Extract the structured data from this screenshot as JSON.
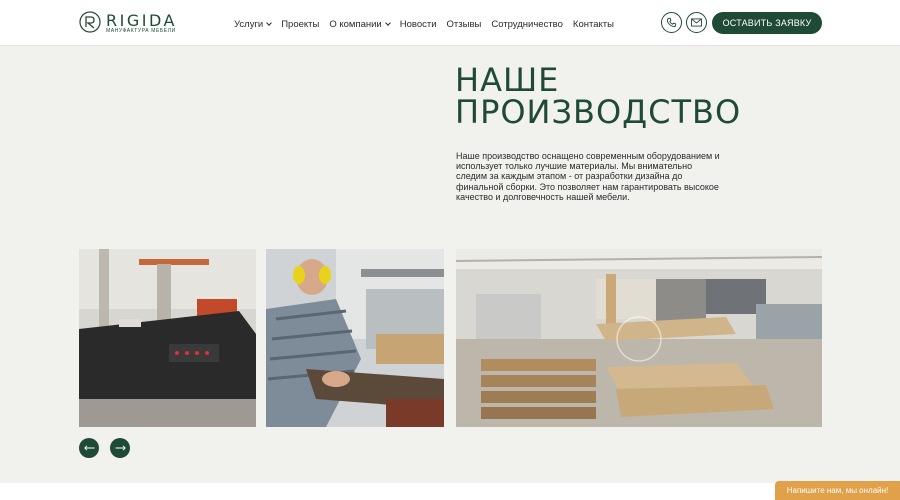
{
  "brand": {
    "name": "RIGIDA",
    "subtitle": "МАНУФАКТУРА МЕБЕЛИ"
  },
  "nav": [
    {
      "label": "Услуги",
      "dropdown": true
    },
    {
      "label": "Проекты",
      "dropdown": false
    },
    {
      "label": "О компании",
      "dropdown": true
    },
    {
      "label": "Новости",
      "dropdown": false
    },
    {
      "label": "Отзывы",
      "dropdown": false
    },
    {
      "label": "Сотрудничество",
      "dropdown": false
    },
    {
      "label": "Контакты",
      "dropdown": false
    }
  ],
  "header_icons": [
    "phone-icon",
    "mail-icon"
  ],
  "cta_label": "ОСТАВИТЬ ЗАЯВКУ",
  "hero": {
    "title_line1": "НАШЕ",
    "title_line2": "ПРОИЗВОДСТВО",
    "description": "Наше производство оснащено современным оборудованием и использует только лучшие материалы. Мы внимательно следим за каждым этапом - от разработки дизайна до финальной сборки. Это позволяет нам гарантировать высокое качество и долговечность нашей мебели."
  },
  "gallery": {
    "photos": [
      "cnc-machine-photo",
      "worker-at-saw-photo",
      "workshop-floor-photo"
    ],
    "prev_icon": "arrow-left-icon",
    "next_icon": "arrow-right-icon"
  },
  "chat_widget": {
    "label": "Напишите нам, мы онлайн!"
  },
  "colors": {
    "brand_green": "#1f4a36",
    "background": "#f1f1ee",
    "chat_orange": "#e0a14a"
  }
}
